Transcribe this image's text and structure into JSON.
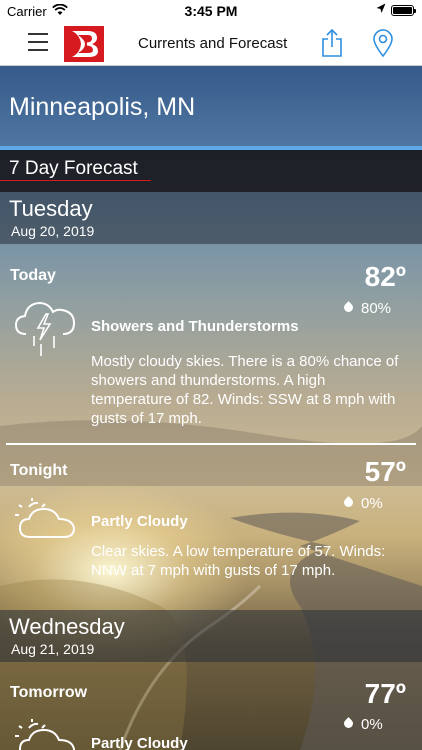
{
  "status_bar": {
    "carrier": "Carrier",
    "time": "3:45 PM"
  },
  "nav": {
    "title": "Currents and Forecast",
    "logo_color": "#d71920"
  },
  "location": {
    "city": "Minneapolis, MN"
  },
  "forecast_section": {
    "title": "7 Day Forecast"
  },
  "days": [
    {
      "day": "Tuesday",
      "date": "Aug 20, 2019",
      "periods": [
        {
          "label": "Today",
          "temp": "82º",
          "precip": "80%",
          "icon": "thunderstorm-icon",
          "condition": "Showers and Thunderstorms",
          "description": "Mostly cloudy skies. There is a 80% chance of showers and thunderstorms.  A high temperature of 82.  Winds: SSW at 8 mph with gusts of 17 mph."
        },
        {
          "label": "Tonight",
          "temp": "57º",
          "precip": "0%",
          "icon": "partly-cloudy-icon",
          "condition": "Partly Cloudy",
          "description": "Clear skies.  A low temperature of 57.  Winds: NNW at 7 mph with gusts of 17 mph."
        }
      ]
    },
    {
      "day": "Wednesday",
      "date": "Aug 21, 2019",
      "periods": [
        {
          "label": "Tomorrow",
          "temp": "77º",
          "precip": "0%",
          "icon": "partly-cloudy-icon",
          "condition": "Partly Cloudy"
        }
      ]
    }
  ],
  "colors": {
    "accent_red": "#d71920",
    "accent_blue": "#5ea8e6"
  }
}
